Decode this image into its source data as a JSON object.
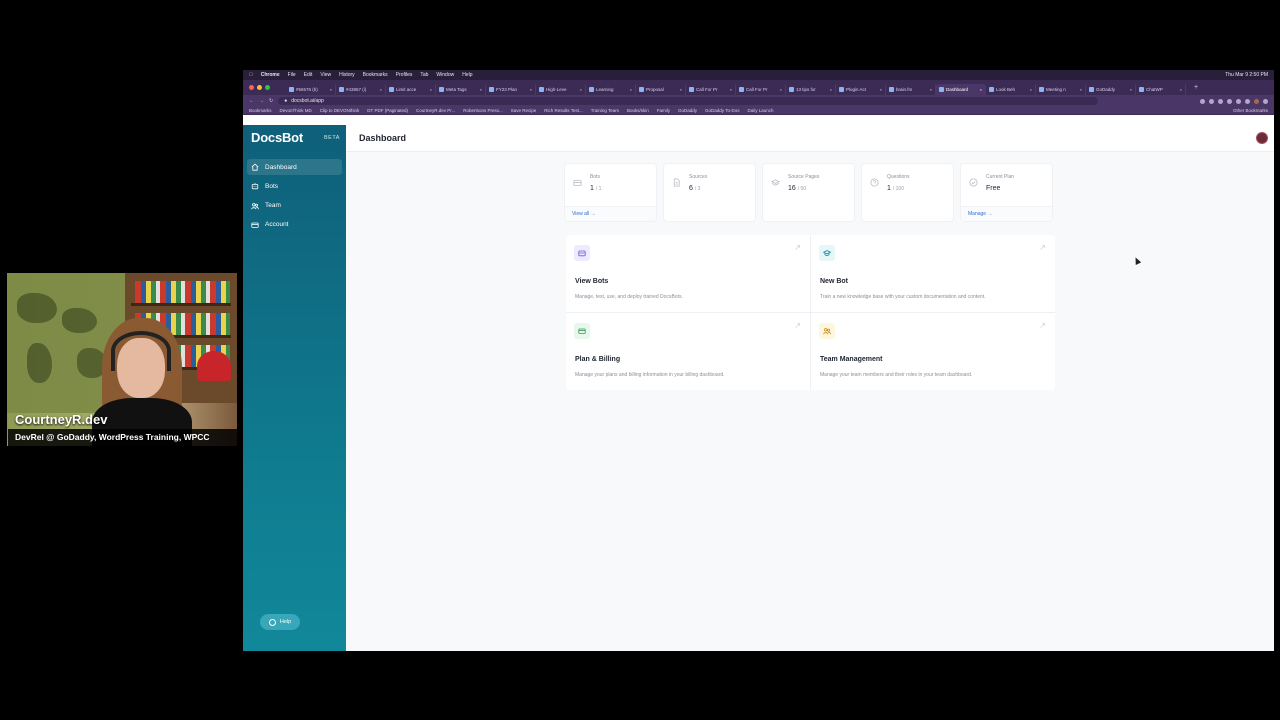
{
  "webcam": {
    "name": "CourtneyR.dev",
    "subtitle": "DevRel @ GoDaddy, WordPress Training, WPCC"
  },
  "os_menubar": {
    "app": "Chrome",
    "menus": [
      "File",
      "Edit",
      "View",
      "History",
      "Bookmarks",
      "Profiles",
      "Tab",
      "Window",
      "Help"
    ],
    "clock": "Thu Mar 9  2:50 PM"
  },
  "browser": {
    "tabs": [
      {
        "label": "#56576 (b)"
      },
      {
        "label": "#43867 (i)"
      },
      {
        "label": "Limit acce"
      },
      {
        "label": "Meta Tags"
      },
      {
        "label": "FY23 Plan"
      },
      {
        "label": "High-Leve"
      },
      {
        "label": "Learning"
      },
      {
        "label": "Proposal"
      },
      {
        "label": "Call For Pr"
      },
      {
        "label": "Call For Pr"
      },
      {
        "label": "13 tips for"
      },
      {
        "label": "Plugin Act"
      },
      {
        "label": "brain.fm"
      },
      {
        "label": "Dashboard",
        "active": true
      },
      {
        "label": "Look Beh"
      },
      {
        "label": "Meeting n"
      },
      {
        "label": "GoDaddy"
      },
      {
        "label": "ChatWP"
      }
    ],
    "url": "docsbot.ai/app",
    "bookmarks": [
      "Bookmarks",
      "DevonThink MD",
      "Clip to DEVONthink",
      "DT PDF (Paginated)",
      "CourtneyR.dev Pr...",
      "Robertsons Press...",
      "Save Recipe",
      "Rich Results Test...",
      "Training Team",
      "Books/skin",
      "Family",
      "GoDaddy",
      "GoDaddy To-Dos",
      "Daily Launch"
    ],
    "other_bookmarks": "Other Bookmarks"
  },
  "app": {
    "logo": "DocsBot",
    "badge": "BETA",
    "nav": [
      {
        "label": "Dashboard",
        "icon": "home-icon",
        "active": true
      },
      {
        "label": "Bots",
        "icon": "bot-icon"
      },
      {
        "label": "Team",
        "icon": "team-icon"
      },
      {
        "label": "Account",
        "icon": "credit-card-icon"
      }
    ],
    "help_label": "Help",
    "page_title": "Dashboard"
  },
  "stats": [
    {
      "label": "Bots",
      "value": "1",
      "max": "/ 1",
      "link": "View all →",
      "icon": "bot-icon"
    },
    {
      "label": "Sources",
      "value": "6",
      "max": "/ 3",
      "icon": "document-icon"
    },
    {
      "label": "Source Pages",
      "value": "16",
      "max": "/ 50",
      "icon": "stack-icon"
    },
    {
      "label": "Questions",
      "value": "1",
      "max": "/ 100",
      "icon": "question-icon"
    },
    {
      "label": "Current Plan",
      "value": "Free",
      "max": "",
      "link": "Manage →",
      "icon": "check-circle-icon"
    }
  ],
  "cards": [
    {
      "title": "View Bots",
      "desc": "Manage, test, use, and deploy trained DocsBots.",
      "icon": "bot-icon",
      "icon_bg": "#eeeaff",
      "icon_color": "#6d5bd0"
    },
    {
      "title": "New Bot",
      "desc": "Train a new knowledge base with your custom documentation and content.",
      "icon": "graduation-cap-icon",
      "icon_bg": "#e6f6f9",
      "icon_color": "#0f8aa0"
    },
    {
      "title": "Plan & Billing",
      "desc": "Manage your plans and billing information in your billing dashboard.",
      "icon": "receipt-icon",
      "icon_bg": "#e7f7ec",
      "icon_color": "#2f9a55"
    },
    {
      "title": "Team Management",
      "desc": "Manage your team members and their roles in your team dashboard.",
      "icon": "users-icon",
      "icon_bg": "#fff6e0",
      "icon_color": "#c78a12"
    }
  ],
  "colors": {
    "sidebar": "#0f6f86",
    "accent": "#2b6fd6",
    "browser_chrome": "#3b2b55"
  }
}
